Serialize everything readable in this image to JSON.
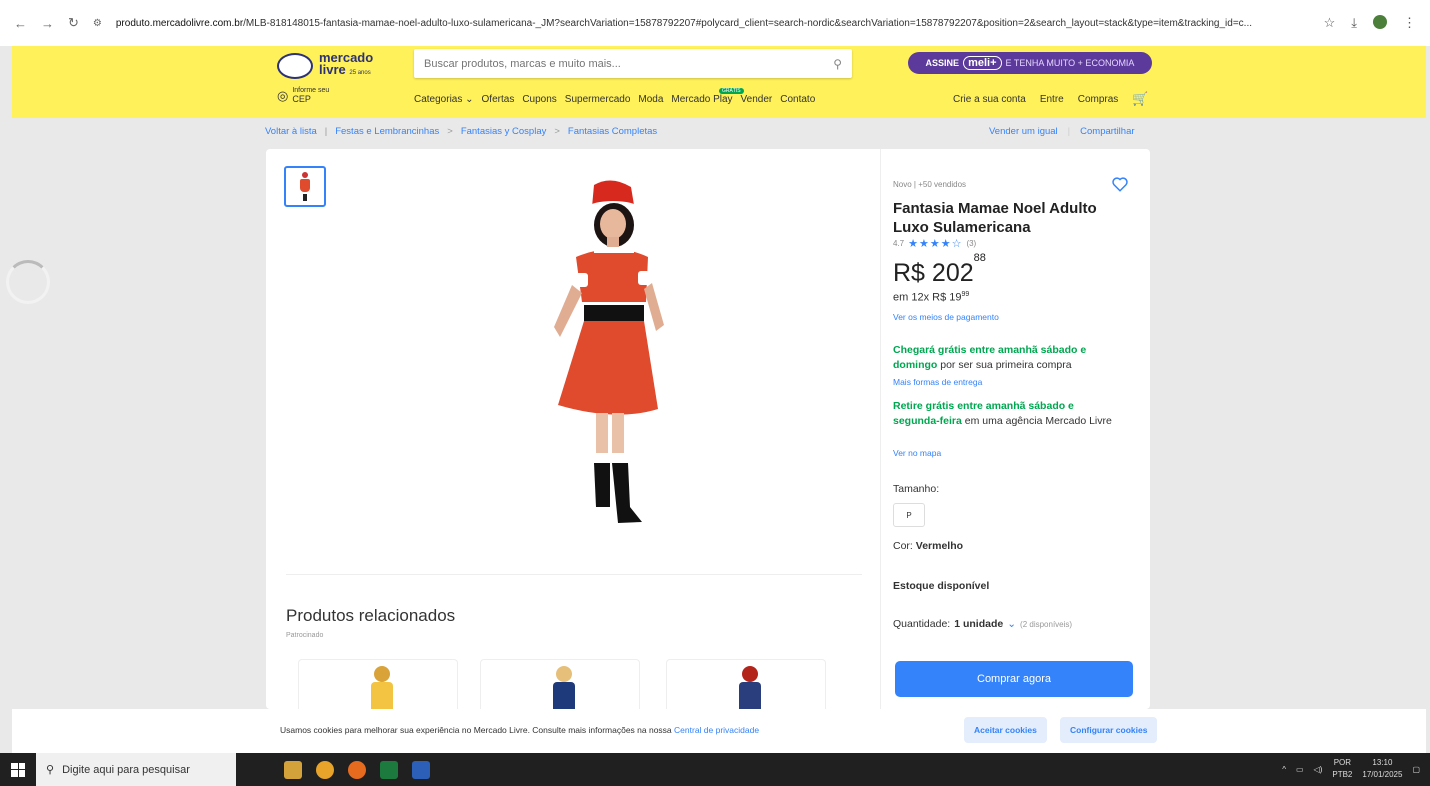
{
  "browser": {
    "url_host": "produto.mercadolivre.com.br",
    "url_path": "/MLB-818148015-fantasia-mamae-noel-adulto-luxo-sulamericana-_JM?searchVariation=15878792207#polycard_client=search-nordic&searchVariation=15878792207&position=2&search_layout=stack&type=item&tracking_id=c..."
  },
  "header": {
    "logo_line1": "mercado",
    "logo_line2": "livre",
    "logo_badge": "25 anos",
    "search_placeholder": "Buscar produtos, marcas e muito mais...",
    "meli_assine": "ASSINE",
    "meli_pill": "meli+",
    "meli_rest": "E TENHA MUITO + ECONOMIA",
    "cep_line1": "Informe seu",
    "cep_line2": "CEP",
    "nav": [
      "Categorias ⌄",
      "Ofertas",
      "Cupons",
      "Supermercado",
      "Moda",
      "Mercado Play",
      "Vender",
      "Contato"
    ],
    "play_badge": "GRÁTIS",
    "user_nav": [
      "Crie a sua conta",
      "Entre",
      "Compras"
    ]
  },
  "breadcrumb": {
    "back": "Voltar à lista",
    "items": [
      "Festas e Lembrancinhas",
      "Fantasias y Cosplay",
      "Fantasias Completas"
    ],
    "sell_same": "Vender um igual",
    "share": "Compartilhar"
  },
  "product": {
    "condition": "Novo  |  +50 vendidos",
    "title": "Fantasia Mamae Noel Adulto Luxo Sulamericana",
    "rating_value": "4.7",
    "rating_stars": "★★★★☆",
    "rating_count": "(3)",
    "price_currency": "R$",
    "price_int": "202",
    "price_cents": "88",
    "installments_prefix": "em 12x R$ 19",
    "installments_cents": "99",
    "payment_link": "Ver os meios de pagamento",
    "ship1_green": "Chegará grátis entre amanhã sábado e domingo",
    "ship1_rest": " por ser sua primeira compra",
    "ship1_link": "Mais formas de entrega",
    "ship2_green": "Retire grátis entre amanhã sábado e segunda-feira",
    "ship2_rest": " em uma agência Mercado Livre",
    "ship2_link": "Ver no mapa",
    "size_label": "Tamanho:",
    "size_value": "P",
    "color_label": "Cor: ",
    "color_value": "Vermelho",
    "stock": "Estoque disponível",
    "qty_label": "Quantidade: ",
    "qty_value": "1 unidade",
    "qty_avail": "(2 disponíveis)",
    "buy_now": "Comprar agora"
  },
  "related": {
    "title": "Produtos relacionados",
    "sponsored": "Patrocinado"
  },
  "cookies": {
    "text": "Usamos cookies para melhorar sua experiência no Mercado Livre. Consulte mais informações na nossa ",
    "link": "Central de privacidade",
    "accept": "Aceitar cookies",
    "configure": "Configurar cookies"
  },
  "taskbar": {
    "search_placeholder": "Digite aqui para pesquisar",
    "lang": "POR",
    "lang2": "PTB2",
    "time": "13:10",
    "date": "17/01/2025"
  },
  "colors": {
    "header_yellow": "#fff159",
    "accent_blue": "#3483fa",
    "green": "#00a650",
    "meli_purple": "#5c3a9b"
  }
}
